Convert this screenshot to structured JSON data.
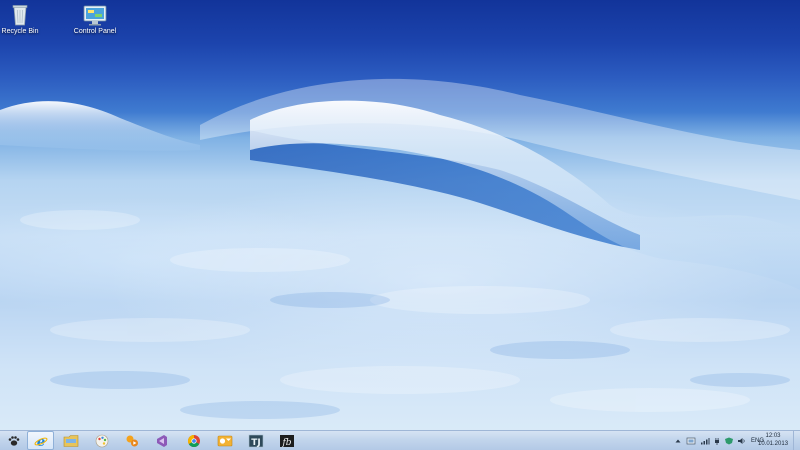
{
  "desktop": {
    "icons": [
      {
        "label": "Recycle Bin",
        "icon": "recycle-bin-icon"
      },
      {
        "label": "Control Panel",
        "icon": "control-panel-icon"
      }
    ]
  },
  "taskbar": {
    "start_icon": "paw-start-icon",
    "pinned": [
      {
        "name": "internet-explorer",
        "icon": "internet-explorer-icon",
        "active": true
      },
      {
        "name": "file-explorer",
        "icon": "folder-icon",
        "active": false
      },
      {
        "name": "paint",
        "icon": "palette-icon",
        "active": false
      },
      {
        "name": "media-player",
        "icon": "media-player-icon",
        "active": false
      },
      {
        "name": "visual-studio",
        "icon": "visual-studio-icon",
        "active": false
      },
      {
        "name": "chrome",
        "icon": "chrome-icon",
        "active": false
      },
      {
        "name": "outlook",
        "icon": "outlook-icon",
        "active": false
      },
      {
        "name": "text-editor",
        "icon": "tj-icon",
        "active": false
      },
      {
        "name": "firebird",
        "icon": "fb-icon",
        "active": false
      }
    ],
    "tray": {
      "language": "ENG",
      "time": "12:03",
      "date": "10.01.2013"
    }
  }
}
